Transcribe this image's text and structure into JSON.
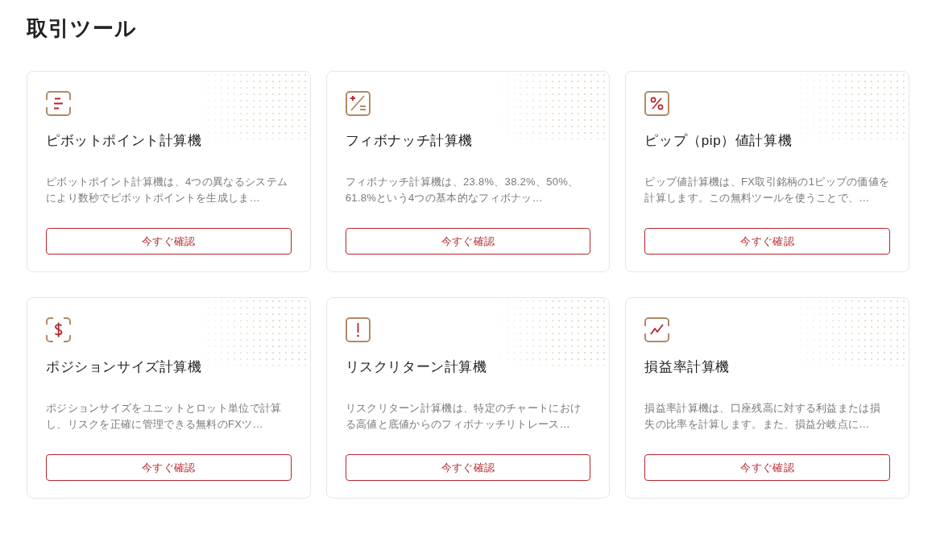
{
  "page": {
    "title": "取引ツール"
  },
  "tools": [
    {
      "title": "ピボットポイント計算機",
      "description": "ピボットポイント計算機は、4つの異なるシステムにより数秒でピボットポイントを生成しま…",
      "button": "今すぐ確認"
    },
    {
      "title": "フィボナッチ計算機",
      "description": "フィボナッチ計算機は、23.8%、38.2%、50%、61.8%という4つの基本的なフィボナッ…",
      "button": "今すぐ確認"
    },
    {
      "title": "ピップ（pip）値計算機",
      "description": "ピップ値計算機は、FX取引銘柄の1ピップの価値を計算します。この無料ツールを使うことで、…",
      "button": "今すぐ確認"
    },
    {
      "title": "ポジションサイズ計算機",
      "description": "ポジションサイズをユニットとロット単位で計算し、リスクを正確に管理できる無料のFXツ…",
      "button": "今すぐ確認"
    },
    {
      "title": "リスクリターン計算機",
      "description": "リスクリターン計算機は、特定のチャートにおける高値と底値からのフィボナッチリトレース…",
      "button": "今すぐ確認"
    },
    {
      "title": "損益率計算機",
      "description": "損益率計算機は、口座残高に対する利益または損失の比率を計算します。また、損益分岐点に…",
      "button": "今すぐ確認"
    }
  ]
}
